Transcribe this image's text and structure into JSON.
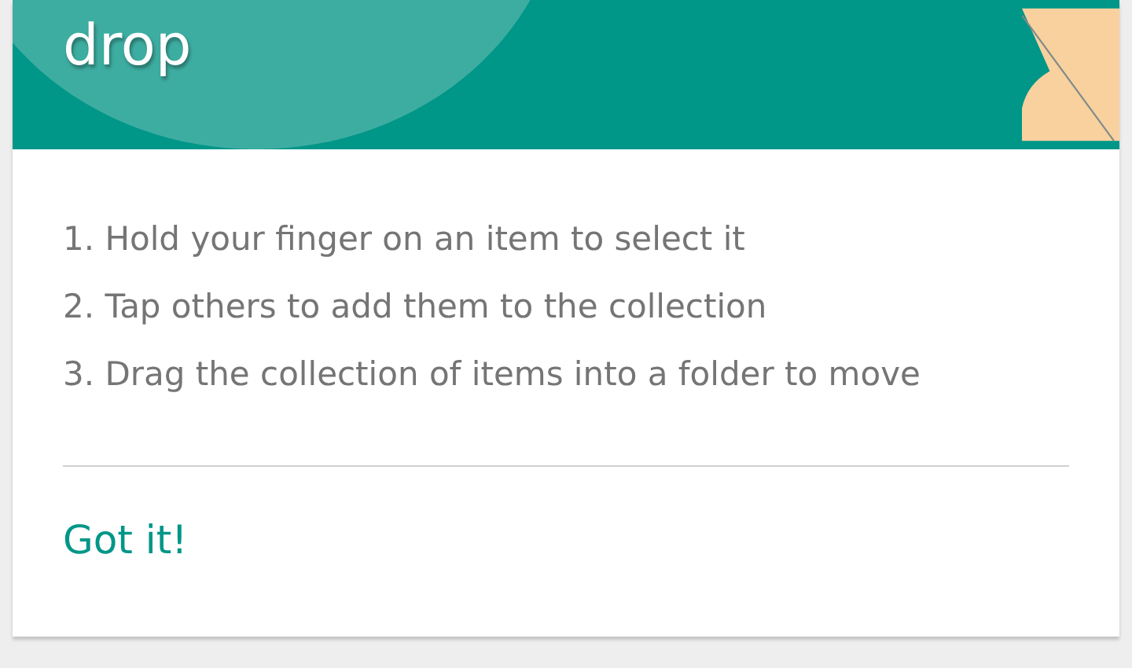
{
  "header": {
    "title": "drop"
  },
  "steps": [
    "1. Hold your finger on an item to select it",
    "2. Tap others to add them to the collection",
    "3. Drag the collection of items into a folder to move"
  ],
  "action": {
    "label": "Got it!"
  }
}
